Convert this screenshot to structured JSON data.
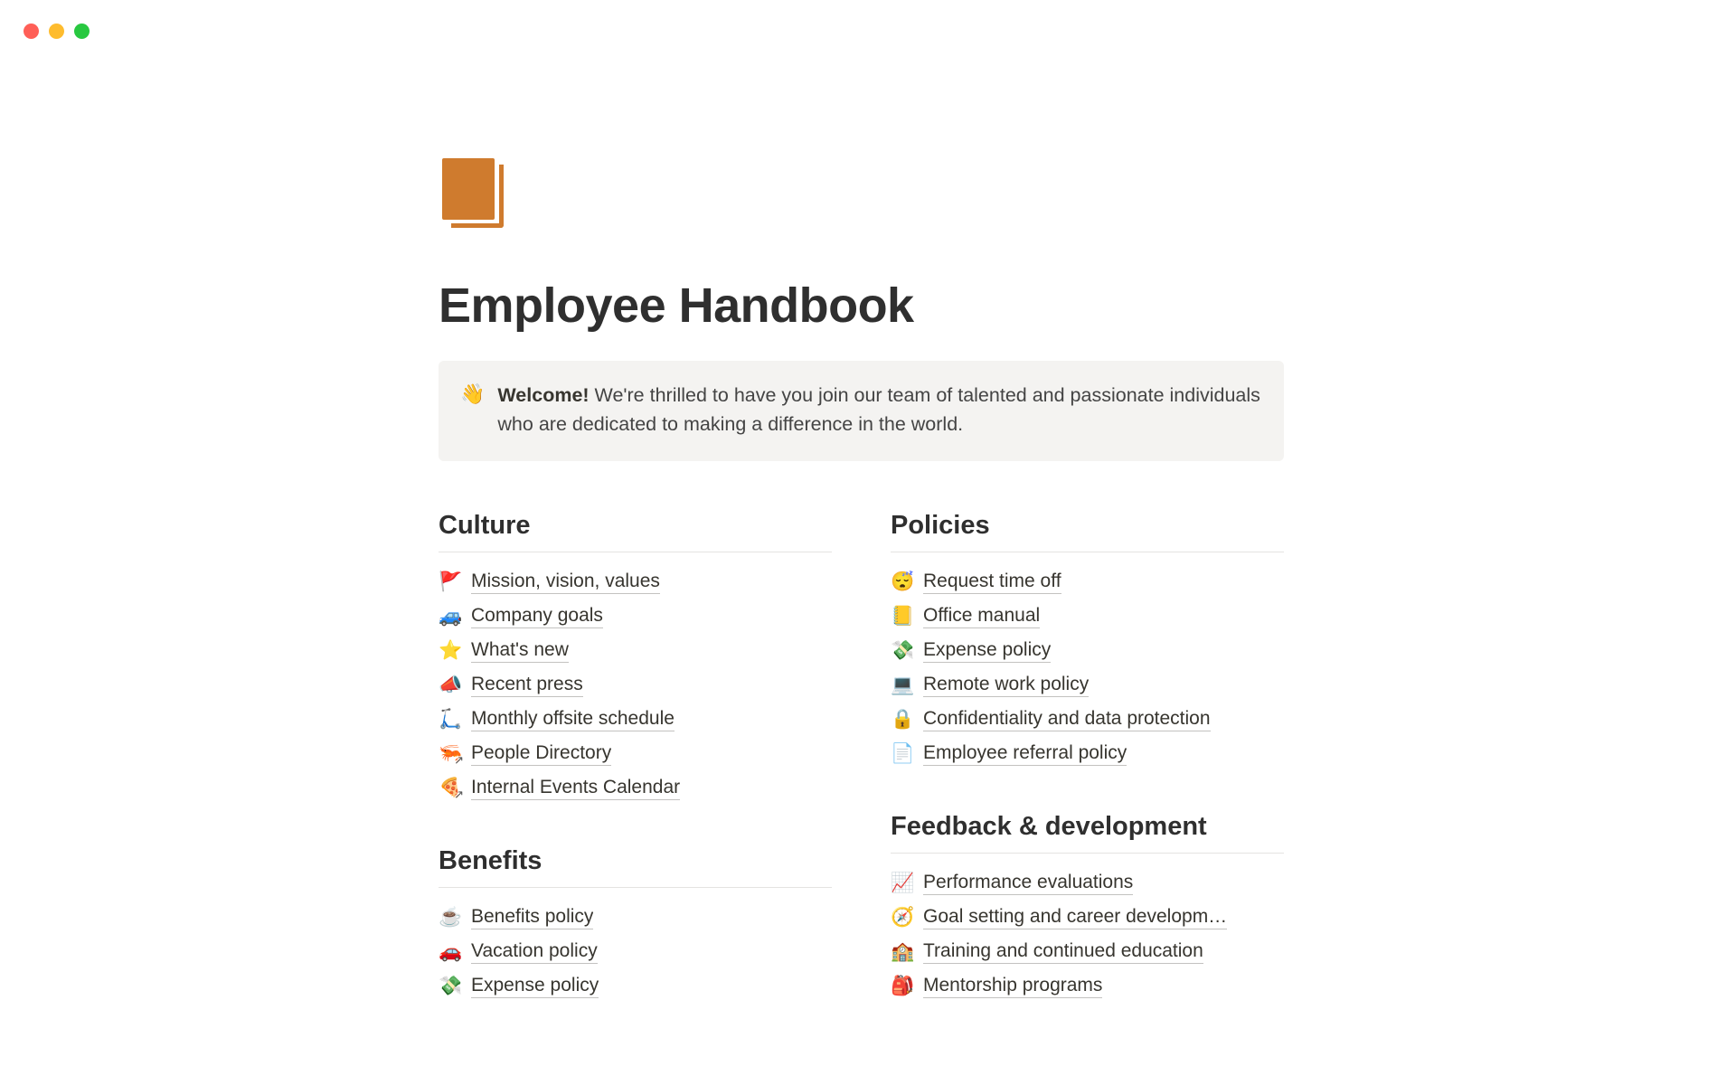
{
  "title": "Employee Handbook",
  "callout": {
    "emoji": "👋",
    "bold": "Welcome!",
    "rest": " We're thrilled to have you join our team of talented and passionate individuals who are dedicated to making a difference in the world."
  },
  "left": [
    {
      "heading": "Culture",
      "items": [
        {
          "emoji": "🚩",
          "label": "Mission, vision, values",
          "arrow": false
        },
        {
          "emoji": "🚙",
          "label": "Company goals",
          "arrow": false
        },
        {
          "emoji": "⭐",
          "label": "What's new",
          "arrow": false
        },
        {
          "emoji": "📣",
          "label": "Recent press",
          "arrow": false
        },
        {
          "emoji": "🛴",
          "label": "Monthly offsite schedule",
          "arrow": false
        },
        {
          "emoji": "🦐",
          "label": "People Directory",
          "arrow": true
        },
        {
          "emoji": "🍕",
          "label": "Internal Events Calendar",
          "arrow": true
        }
      ]
    },
    {
      "heading": "Benefits",
      "items": [
        {
          "emoji": "☕",
          "label": "Benefits policy",
          "arrow": false
        },
        {
          "emoji": "🚗",
          "label": "Vacation policy",
          "arrow": false
        },
        {
          "emoji": "💸",
          "label": "Expense policy",
          "arrow": false
        }
      ]
    }
  ],
  "right": [
    {
      "heading": "Policies",
      "items": [
        {
          "emoji": "😴",
          "label": "Request time off",
          "arrow": false
        },
        {
          "emoji": "📒",
          "label": "Office manual",
          "arrow": false
        },
        {
          "emoji": "💸",
          "label": "Expense policy",
          "arrow": false
        },
        {
          "emoji": "💻",
          "label": "Remote work policy",
          "arrow": false
        },
        {
          "emoji": "🔒",
          "label": "Confidentiality and data protection",
          "arrow": false
        },
        {
          "emoji": "📄",
          "label": "Employee referral policy",
          "arrow": false
        }
      ]
    },
    {
      "heading": "Feedback & development",
      "items": [
        {
          "emoji": "📈",
          "label": "Performance evaluations",
          "arrow": false
        },
        {
          "emoji": "🧭",
          "label": "Goal setting and career developm…",
          "arrow": false
        },
        {
          "emoji": "🏫",
          "label": "Training and continued education",
          "arrow": false
        },
        {
          "emoji": "🎒",
          "label": "Mentorship programs",
          "arrow": false
        }
      ]
    }
  ]
}
